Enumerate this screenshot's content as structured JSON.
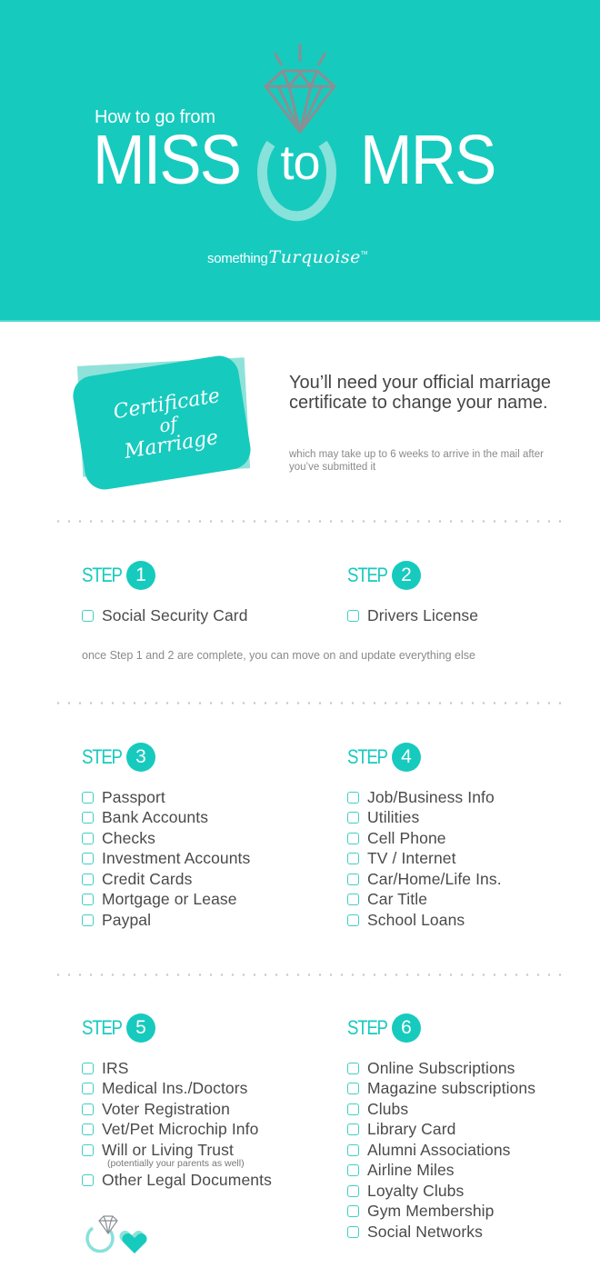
{
  "header": {
    "subtitle": "How to go from",
    "title_left": "MISS",
    "title_middle": "to",
    "title_right": "MRS",
    "brand_prefix": "something",
    "brand_script": "Turquoise",
    "brand_tm": "TM",
    "icon": "diamond-ring-icon"
  },
  "colors": {
    "brand": "#17cabe",
    "brand_light": "#8fe2d9",
    "ring": "#86e2da",
    "diamond_outline": "#8a8f93",
    "text": "#4a4a4a",
    "muted_text": "#8a8a8a"
  },
  "intro": {
    "certificate": {
      "line1": "Certificate",
      "line2": "of",
      "line3": "Marriage"
    },
    "main": "You’ll need your official marriage certificate to change your name.",
    "sub": "which may take up to 6 weeks to arrive in the mail after you’ve submitted it"
  },
  "step_word": "STEP",
  "steps": [
    {
      "number": "1",
      "items": [
        {
          "label": "Social Security Card",
          "checked": false
        }
      ]
    },
    {
      "number": "2",
      "items": [
        {
          "label": "Drivers License",
          "checked": false
        }
      ]
    },
    {
      "number": "3",
      "items": [
        {
          "label": "Passport",
          "checked": false
        },
        {
          "label": "Bank Accounts",
          "checked": false
        },
        {
          "label": "Checks",
          "checked": false
        },
        {
          "label": "Investment Accounts",
          "checked": false
        },
        {
          "label": "Credit Cards",
          "checked": false
        },
        {
          "label": "Mortgage or Lease",
          "checked": false
        },
        {
          "label": "Paypal",
          "checked": false
        }
      ]
    },
    {
      "number": "4",
      "items": [
        {
          "label": "Job/Business Info",
          "checked": false
        },
        {
          "label": "Utilities",
          "checked": false
        },
        {
          "label": "Cell Phone",
          "checked": false
        },
        {
          "label": "TV / Internet",
          "checked": false
        },
        {
          "label": "Car/Home/Life Ins.",
          "checked": false
        },
        {
          "label": "Car Title",
          "checked": false
        },
        {
          "label": "School Loans",
          "checked": false
        }
      ]
    },
    {
      "number": "5",
      "items": [
        {
          "label": "IRS",
          "checked": false
        },
        {
          "label": "Medical Ins./Doctors",
          "checked": false
        },
        {
          "label": "Voter Registration",
          "checked": false
        },
        {
          "label": "Vet/Pet Microchip Info",
          "checked": false
        },
        {
          "label": "Will or Living Trust",
          "note": "(potentially your parents as well)",
          "checked": false
        },
        {
          "label": "Other Legal Documents",
          "checked": false
        }
      ]
    },
    {
      "number": "6",
      "items": [
        {
          "label": "Online Subscriptions",
          "checked": false
        },
        {
          "label": "Magazine subscriptions",
          "checked": false
        },
        {
          "label": "Clubs",
          "checked": false
        },
        {
          "label": "Library Card",
          "checked": false
        },
        {
          "label": "Alumni Associations",
          "checked": false
        },
        {
          "label": "Airline Miles",
          "checked": false
        },
        {
          "label": "Loyalty Clubs",
          "checked": false
        },
        {
          "label": "Gym Membership",
          "checked": false
        },
        {
          "label": "Social Networks",
          "checked": false
        }
      ]
    }
  ],
  "steps_note": "once Step 1 and 2 are complete, you can move on and update everything else",
  "footer": {
    "icons": [
      "ring-icon",
      "heart-icon"
    ]
  }
}
